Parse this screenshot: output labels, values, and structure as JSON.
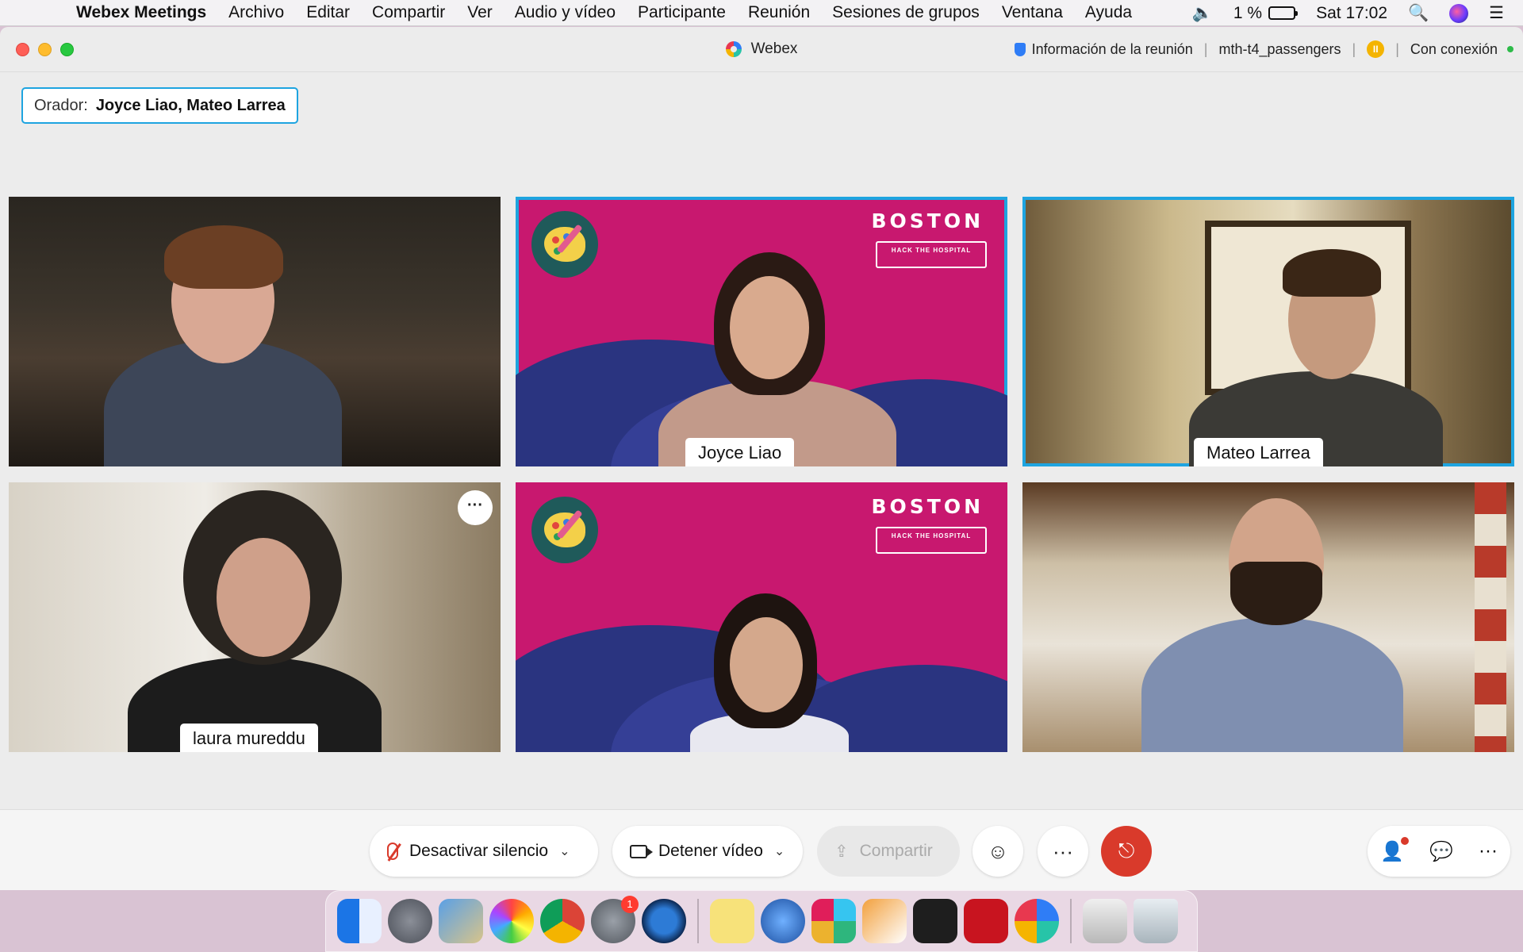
{
  "menubar": {
    "app_name": "Webex Meetings",
    "items": [
      "Archivo",
      "Editar",
      "Compartir",
      "Ver",
      "Audio y vídeo",
      "Participante",
      "Reunión",
      "Sesiones de grupos",
      "Ventana",
      "Ayuda"
    ],
    "battery": "1 %",
    "clock": "Sat 17:02"
  },
  "window": {
    "title": "Webex",
    "meeting_info": "Información de la reunión",
    "meeting_name": "mth-t4_passengers",
    "connection_status": "Con conexión"
  },
  "speaker": {
    "label": "Orador:",
    "names": "Joyce Liao,   Mateo Larrea"
  },
  "tiles": [
    {
      "name": "",
      "active": false
    },
    {
      "name": "Joyce Liao",
      "active": true,
      "background_text": "BOSTON",
      "background_subtext": "HACK THE HOSPITAL"
    },
    {
      "name": "Mateo Larrea",
      "active": true
    },
    {
      "name": "laura mureddu",
      "active": false
    },
    {
      "name": "",
      "active": false,
      "background_text": "BOSTON",
      "background_subtext": "HACK THE HOSPITAL"
    },
    {
      "name": "",
      "active": false
    }
  ],
  "controls": {
    "mute_label": "Desactivar silencio",
    "video_label": "Detener vídeo",
    "share_label": "Compartir",
    "more": "···"
  },
  "colors": {
    "accent": "#1ea4e0",
    "leave": "#d93a2b",
    "boston_bg": "#c8186f"
  },
  "dock": {
    "system_prefs_badge": "1"
  }
}
